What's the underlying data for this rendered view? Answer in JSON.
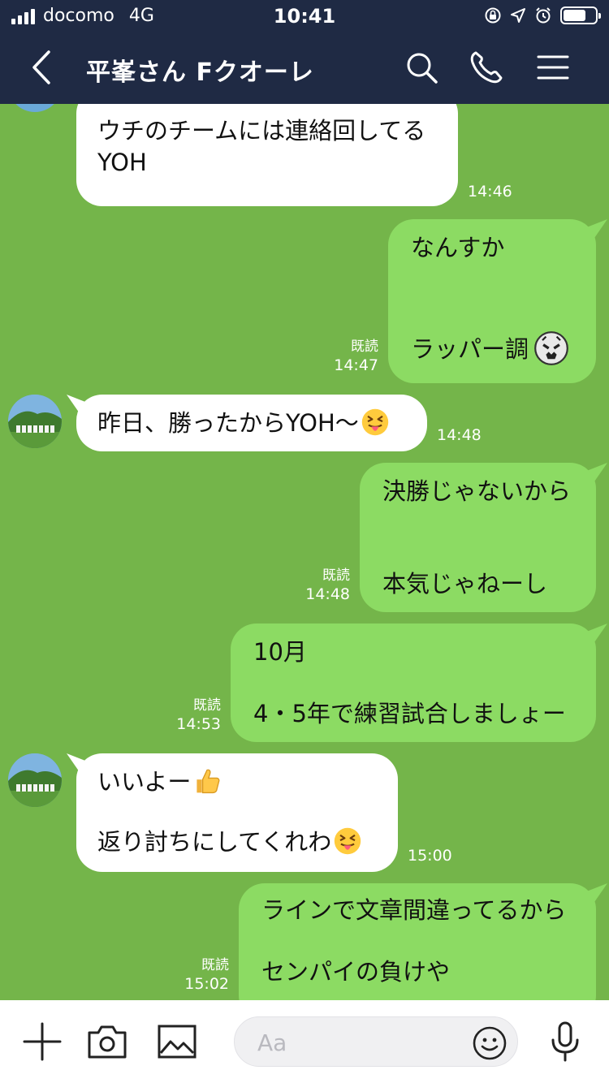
{
  "status_bar": {
    "carrier": "docomo",
    "network": "4G",
    "time": "10:41",
    "battery_level": 0.7
  },
  "header": {
    "title": "平峯さん Fクオーレ"
  },
  "messages": [
    {
      "side": "in",
      "lines": [
        "ウチのチームには連絡回してる",
        "YOH"
      ],
      "time": "14:46"
    },
    {
      "side": "out",
      "lines": [
        "なんすか",
        "ラッパー調"
      ],
      "read": "既読",
      "time": "14:47"
    },
    {
      "side": "in",
      "lines": [
        "昨日、勝ったからYOH〜"
      ],
      "time": "14:48"
    },
    {
      "side": "out",
      "lines": [
        "決勝じゃないから",
        "本気じゃねーし"
      ],
      "read": "既読",
      "time": "14:48"
    },
    {
      "side": "out",
      "lines": [
        "10月",
        "4・5年で練習試合しましょー"
      ],
      "read": "既読",
      "time": "14:53"
    },
    {
      "side": "in",
      "lines": [
        "いいよー",
        "返り討ちにしてくれわ"
      ],
      "time": "15:00"
    },
    {
      "side": "out",
      "lines": [
        "ラインで文章間違ってるから",
        "センパイの負けや"
      ],
      "read": "既読",
      "time": "15:02"
    }
  ],
  "input": {
    "placeholder": "Aa"
  },
  "colors": {
    "header_bg": "#1f2a44",
    "chat_bg": "#74b54a",
    "outgoing_bubble": "#8cdb63",
    "incoming_bubble": "#ffffff"
  }
}
